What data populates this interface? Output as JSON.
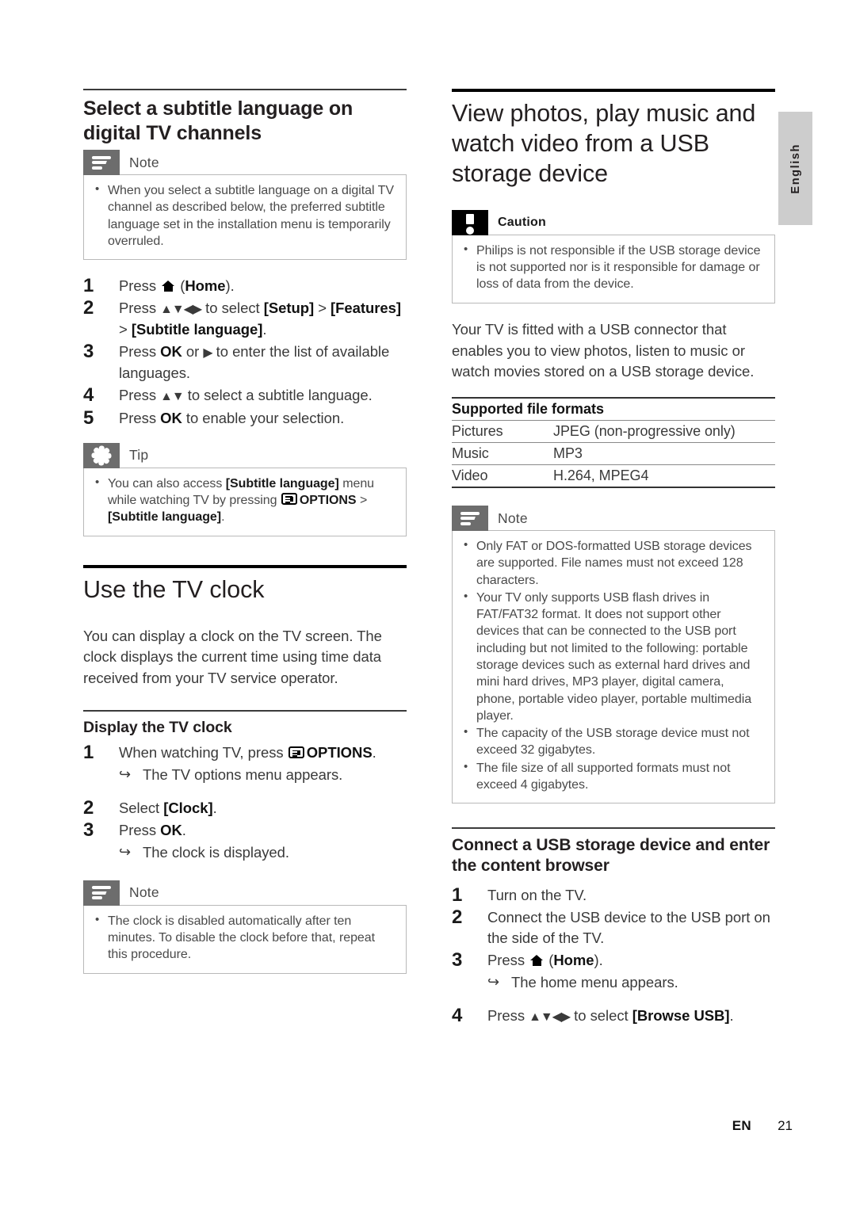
{
  "page": {
    "language_tab": "English",
    "footer": {
      "locale": "EN",
      "page_number": "21"
    }
  },
  "left_column": {
    "section_1": {
      "heading": "Select a subtitle language on digital TV channels",
      "note": {
        "label": "Note",
        "icon": "note-icon",
        "items": [
          "When you select a subtitle language on a digital TV channel as described below, the preferred subtitle language set in the installation menu is temporarily overruled."
        ]
      },
      "steps": [
        {
          "num": "1",
          "text_before": "Press ",
          "icon": "home-icon",
          "text_after": " (",
          "bold": "Home",
          "text_end": ")."
        },
        {
          "num": "2",
          "text_before": "Press ",
          "icon": "arrows-updownleftright",
          "text_after": " to select ",
          "bold": "[Setup]",
          "text_mid": " > ",
          "bold2": "[Features]",
          "text_mid2": " > ",
          "bold3": "[Subtitle language]",
          "text_end": "."
        },
        {
          "num": "3",
          "text_before": "Press ",
          "bold": "OK",
          "text_mid": " or ",
          "icon": "arrow-right",
          "text_end": " to enter the list of available languages."
        },
        {
          "num": "4",
          "text_before": "Press ",
          "icon": "arrows-updown",
          "text_end": " to select a subtitle language."
        },
        {
          "num": "5",
          "text_before": "Press ",
          "bold": "OK",
          "text_end": " to enable your selection."
        }
      ],
      "tip": {
        "label": "Tip",
        "icon": "tip-icon",
        "item_part1": "You can also access ",
        "item_bold1": "[Subtitle language]",
        "item_part2": " menu while watching TV by pressing ",
        "item_icon": "options-icon",
        "item_bold2": "OPTIONS",
        "item_part3": " > ",
        "item_bold3": "[Subtitle language]",
        "item_part4": "."
      }
    },
    "section_2": {
      "heading": "Use the TV clock",
      "intro": "You can display a clock on the TV screen. The clock displays the current time using time data received from your TV service operator.",
      "subheading": "Display the TV clock",
      "steps": [
        {
          "num": "1",
          "text_before": "When watching TV, press ",
          "icon": "options-icon",
          "bold": "OPTIONS",
          "text_end": ".",
          "sub": "The TV options menu appears."
        },
        {
          "num": "2",
          "text_before": "Select ",
          "bold": "[Clock]",
          "text_end": "."
        },
        {
          "num": "3",
          "text_before": "Press ",
          "bold": "OK",
          "text_end": ".",
          "sub": "The clock is displayed."
        }
      ],
      "note": {
        "label": "Note",
        "icon": "note-icon",
        "items": [
          "The clock is disabled automatically after ten minutes. To disable the clock before that, repeat this procedure."
        ]
      }
    }
  },
  "right_column": {
    "section_1": {
      "heading": "View photos, play music and watch video from a USB storage device",
      "caution": {
        "label": "Caution",
        "icon": "caution-icon",
        "items": [
          "Philips is not responsible if the USB storage device is not supported nor is it responsible for damage or loss of data from the device."
        ]
      },
      "intro": "Your TV is fitted with a USB connector that enables you to view photos, listen to music or watch movies stored on a USB storage device.",
      "table": {
        "header": "Supported file formats",
        "rows": [
          {
            "key": "Pictures",
            "value": "JPEG (non-progressive only)"
          },
          {
            "key": "Music",
            "value": "MP3"
          },
          {
            "key": "Video",
            "value": "H.264, MPEG4"
          }
        ]
      },
      "note": {
        "label": "Note",
        "icon": "note-icon",
        "items": [
          "Only FAT or DOS-formatted USB storage devices are supported. File names must not exceed 128 characters.",
          "Your TV only supports USB flash drives in FAT/FAT32 format. It does not support other devices that can be connected to the USB port including but not limited to the following: portable storage devices such as external hard drives and mini hard drives, MP3 player, digital camera, phone, portable video player, portable multimedia player.",
          "The capacity of the USB storage device must not exceed 32 gigabytes.",
          "The file size of all supported formats must not exceed 4 gigabytes."
        ]
      }
    },
    "section_2": {
      "heading": "Connect a USB storage device and enter the content browser",
      "steps": [
        {
          "num": "1",
          "text_before": "Turn on the TV."
        },
        {
          "num": "2",
          "text_before": "Connect the USB device to the USB port on the side of the TV."
        },
        {
          "num": "3",
          "text_before": "Press ",
          "icon": "home-icon",
          "text_after": " (",
          "bold": "Home",
          "text_end": ").",
          "sub": "The home menu appears."
        },
        {
          "num": "4",
          "text_before": "Press ",
          "icon": "arrows-updownleftright",
          "text_after": " to select ",
          "bold": "[Browse USB]",
          "text_end": "."
        }
      ]
    }
  }
}
